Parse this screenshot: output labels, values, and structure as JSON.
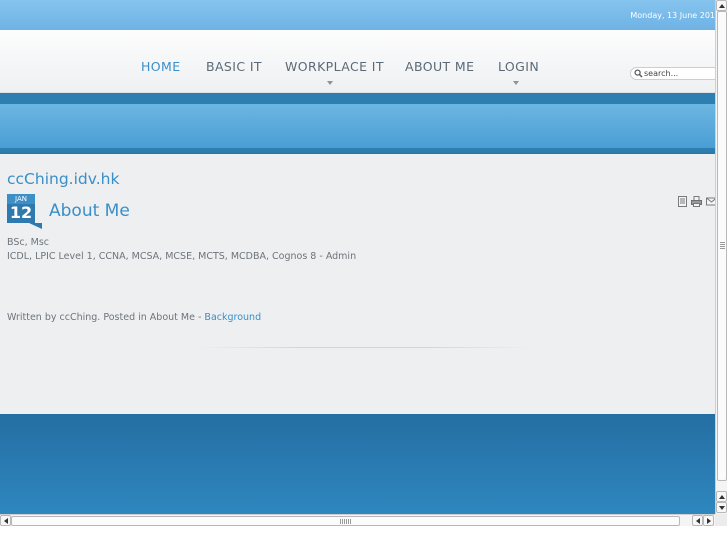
{
  "header": {
    "date": "Monday, 13 June 201"
  },
  "nav": {
    "items": [
      {
        "label": "HOME",
        "active": true,
        "has_submenu": false
      },
      {
        "label": "BASIC IT",
        "active": false,
        "has_submenu": false
      },
      {
        "label": "WORKPLACE IT",
        "active": false,
        "has_submenu": true
      },
      {
        "label": "ABOUT ME",
        "active": false,
        "has_submenu": false
      },
      {
        "label": "LOGIN",
        "active": false,
        "has_submenu": true
      }
    ]
  },
  "search": {
    "placeholder": "search..."
  },
  "content": {
    "site_title": "ccChing.idv.hk",
    "date_badge": {
      "month": "JAN",
      "day": "12"
    },
    "article_title": "About Me",
    "tools": [
      "pdf-icon",
      "print-icon",
      "email-icon"
    ],
    "lines": [
      "BSc, Msc",
      "ICDL, LPIC Level 1, CCNA, MCSA, MCSE, MCTS, MCDBA, Cognos 8 - Admin"
    ],
    "meta": {
      "prefix": "Written by ccChing. Posted in About Me - ",
      "link": "Background"
    }
  },
  "colors": {
    "accent": "#3a8fc8",
    "top_bar": "#7ebcea",
    "band": "#5aa8da",
    "footer": "#2a7cb3",
    "content_bg": "#eeeff1"
  }
}
